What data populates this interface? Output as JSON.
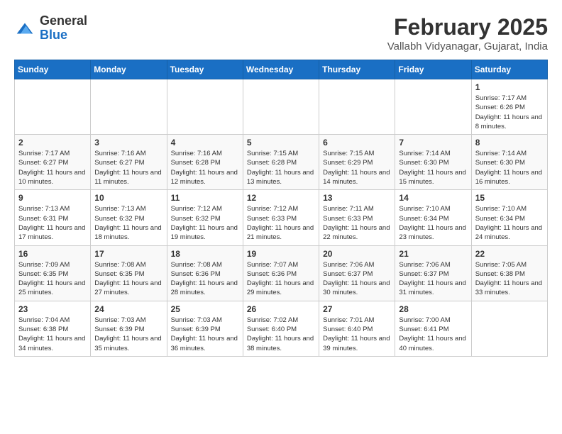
{
  "header": {
    "logo_general": "General",
    "logo_blue": "Blue",
    "title": "February 2025",
    "subtitle": "Vallabh Vidyanagar, Gujarat, India"
  },
  "calendar": {
    "weekdays": [
      "Sunday",
      "Monday",
      "Tuesday",
      "Wednesday",
      "Thursday",
      "Friday",
      "Saturday"
    ],
    "weeks": [
      [
        {
          "day": "",
          "info": ""
        },
        {
          "day": "",
          "info": ""
        },
        {
          "day": "",
          "info": ""
        },
        {
          "day": "",
          "info": ""
        },
        {
          "day": "",
          "info": ""
        },
        {
          "day": "",
          "info": ""
        },
        {
          "day": "1",
          "info": "Sunrise: 7:17 AM\nSunset: 6:26 PM\nDaylight: 11 hours and 8 minutes."
        }
      ],
      [
        {
          "day": "2",
          "info": "Sunrise: 7:17 AM\nSunset: 6:27 PM\nDaylight: 11 hours and 10 minutes."
        },
        {
          "day": "3",
          "info": "Sunrise: 7:16 AM\nSunset: 6:27 PM\nDaylight: 11 hours and 11 minutes."
        },
        {
          "day": "4",
          "info": "Sunrise: 7:16 AM\nSunset: 6:28 PM\nDaylight: 11 hours and 12 minutes."
        },
        {
          "day": "5",
          "info": "Sunrise: 7:15 AM\nSunset: 6:28 PM\nDaylight: 11 hours and 13 minutes."
        },
        {
          "day": "6",
          "info": "Sunrise: 7:15 AM\nSunset: 6:29 PM\nDaylight: 11 hours and 14 minutes."
        },
        {
          "day": "7",
          "info": "Sunrise: 7:14 AM\nSunset: 6:30 PM\nDaylight: 11 hours and 15 minutes."
        },
        {
          "day": "8",
          "info": "Sunrise: 7:14 AM\nSunset: 6:30 PM\nDaylight: 11 hours and 16 minutes."
        }
      ],
      [
        {
          "day": "9",
          "info": "Sunrise: 7:13 AM\nSunset: 6:31 PM\nDaylight: 11 hours and 17 minutes."
        },
        {
          "day": "10",
          "info": "Sunrise: 7:13 AM\nSunset: 6:32 PM\nDaylight: 11 hours and 18 minutes."
        },
        {
          "day": "11",
          "info": "Sunrise: 7:12 AM\nSunset: 6:32 PM\nDaylight: 11 hours and 19 minutes."
        },
        {
          "day": "12",
          "info": "Sunrise: 7:12 AM\nSunset: 6:33 PM\nDaylight: 11 hours and 21 minutes."
        },
        {
          "day": "13",
          "info": "Sunrise: 7:11 AM\nSunset: 6:33 PM\nDaylight: 11 hours and 22 minutes."
        },
        {
          "day": "14",
          "info": "Sunrise: 7:10 AM\nSunset: 6:34 PM\nDaylight: 11 hours and 23 minutes."
        },
        {
          "day": "15",
          "info": "Sunrise: 7:10 AM\nSunset: 6:34 PM\nDaylight: 11 hours and 24 minutes."
        }
      ],
      [
        {
          "day": "16",
          "info": "Sunrise: 7:09 AM\nSunset: 6:35 PM\nDaylight: 11 hours and 25 minutes."
        },
        {
          "day": "17",
          "info": "Sunrise: 7:08 AM\nSunset: 6:35 PM\nDaylight: 11 hours and 27 minutes."
        },
        {
          "day": "18",
          "info": "Sunrise: 7:08 AM\nSunset: 6:36 PM\nDaylight: 11 hours and 28 minutes."
        },
        {
          "day": "19",
          "info": "Sunrise: 7:07 AM\nSunset: 6:36 PM\nDaylight: 11 hours and 29 minutes."
        },
        {
          "day": "20",
          "info": "Sunrise: 7:06 AM\nSunset: 6:37 PM\nDaylight: 11 hours and 30 minutes."
        },
        {
          "day": "21",
          "info": "Sunrise: 7:06 AM\nSunset: 6:37 PM\nDaylight: 11 hours and 31 minutes."
        },
        {
          "day": "22",
          "info": "Sunrise: 7:05 AM\nSunset: 6:38 PM\nDaylight: 11 hours and 33 minutes."
        }
      ],
      [
        {
          "day": "23",
          "info": "Sunrise: 7:04 AM\nSunset: 6:38 PM\nDaylight: 11 hours and 34 minutes."
        },
        {
          "day": "24",
          "info": "Sunrise: 7:03 AM\nSunset: 6:39 PM\nDaylight: 11 hours and 35 minutes."
        },
        {
          "day": "25",
          "info": "Sunrise: 7:03 AM\nSunset: 6:39 PM\nDaylight: 11 hours and 36 minutes."
        },
        {
          "day": "26",
          "info": "Sunrise: 7:02 AM\nSunset: 6:40 PM\nDaylight: 11 hours and 38 minutes."
        },
        {
          "day": "27",
          "info": "Sunrise: 7:01 AM\nSunset: 6:40 PM\nDaylight: 11 hours and 39 minutes."
        },
        {
          "day": "28",
          "info": "Sunrise: 7:00 AM\nSunset: 6:41 PM\nDaylight: 11 hours and 40 minutes."
        },
        {
          "day": "",
          "info": ""
        }
      ]
    ]
  }
}
